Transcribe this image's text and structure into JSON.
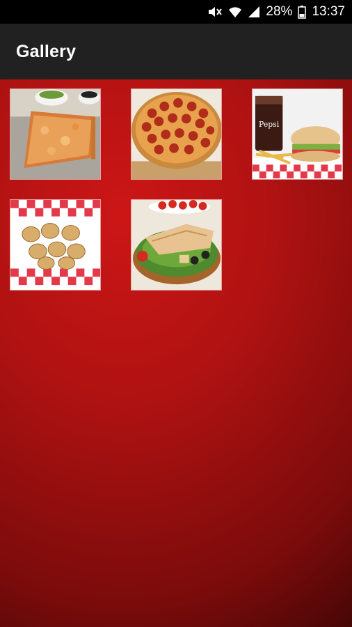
{
  "status_bar": {
    "battery": "28%",
    "time": "13:37"
  },
  "app_bar": {
    "title": "Gallery"
  },
  "gallery": {
    "items": [
      {
        "icon": "cheese-pizza-slice-image"
      },
      {
        "icon": "pepperoni-pizza-image"
      },
      {
        "icon": "sub-sandwich-fries-soda-image"
      },
      {
        "icon": "garlic-knots-image"
      },
      {
        "icon": "chicken-salad-image"
      }
    ]
  },
  "colors": {
    "background": "#b01212",
    "app_bar": "#212121",
    "status_bar": "#000000"
  }
}
